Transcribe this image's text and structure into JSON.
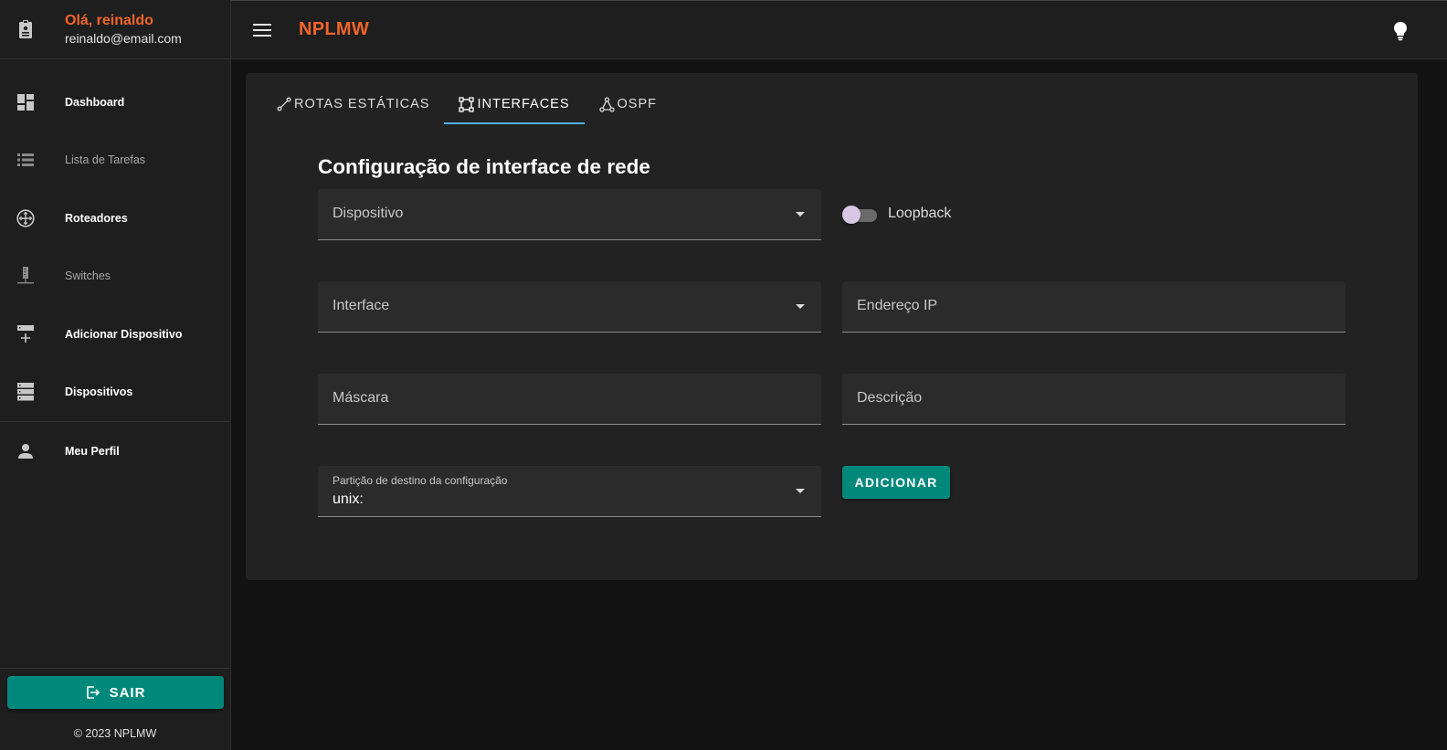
{
  "user": {
    "greeting": "Olá, reinaldo",
    "email": "reinaldo@email.com"
  },
  "nav": {
    "items": [
      {
        "label": "Dashboard",
        "icon": "dashboard-icon"
      },
      {
        "label": "Lista de Tarefas",
        "icon": "list-icon"
      },
      {
        "label": "Roteadores",
        "icon": "router-icon"
      },
      {
        "label": "Switches",
        "icon": "switch-icon"
      },
      {
        "label": "Adicionar Dispositivo",
        "icon": "add-device-icon"
      },
      {
        "label": "Dispositivos",
        "icon": "devices-icon"
      },
      {
        "label": "Meu Perfil",
        "icon": "person-icon"
      }
    ]
  },
  "logout": {
    "label": "SAIR"
  },
  "footer": {
    "copyright": "© 2023 NPLMW"
  },
  "topbar": {
    "brand": "NPLMW"
  },
  "tabs": [
    {
      "label": "ROTAS ESTÁTICAS",
      "icon": "route-icon"
    },
    {
      "label": "INTERFACES",
      "icon": "interface-icon",
      "active": true
    },
    {
      "label": "OSPF",
      "icon": "graph-icon"
    }
  ],
  "form": {
    "title": "Configuração de interface de rede",
    "device_label": "Dispositivo",
    "loopback_label": "Loopback",
    "loopback_on": false,
    "interface_label": "Interface",
    "ip_label": "Endereço IP",
    "mask_label": "Máscara",
    "description_label": "Descrição",
    "partition_label": "Partição de destino da configuração",
    "partition_value": "unix:",
    "add_label": "ADICIONAR"
  },
  "colors": {
    "accent": "#f0642a",
    "button": "#00897b",
    "tab_indicator": "#4fb3f0"
  }
}
